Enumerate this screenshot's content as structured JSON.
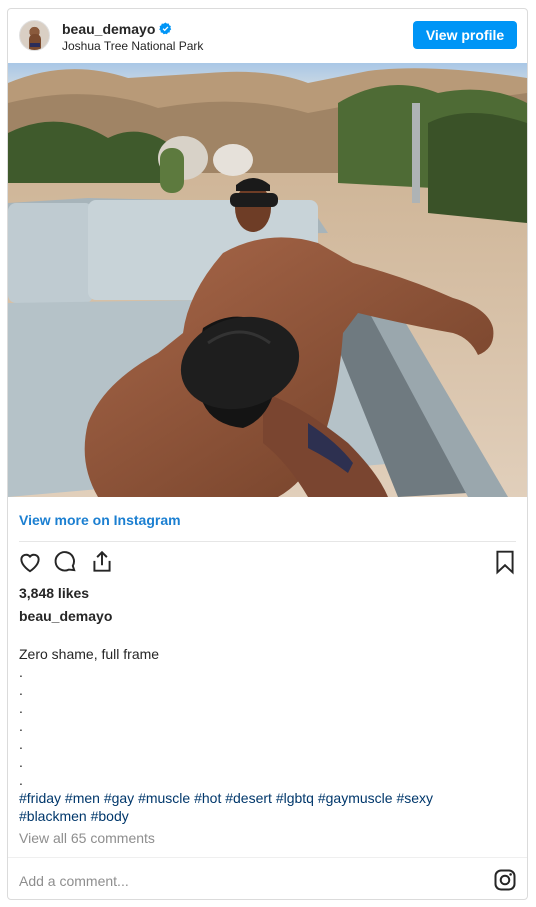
{
  "header": {
    "username": "beau_demayo",
    "location": "Joshua Tree National Park",
    "view_profile_label": "View profile"
  },
  "post": {
    "image_icon": "photo-man-on-couch-desert",
    "view_more_label": "View more on Instagram",
    "likes": "3,848 likes",
    "caption_user": "beau_demayo",
    "caption_text": "Zero shame, full frame",
    "caption_dots": [
      ".",
      ".",
      ".",
      ".",
      ".",
      ".",
      "."
    ],
    "hashtags_line1": "#friday #men #gay #muscle #hot #desert #lgbtq #gaymuscle #sexy",
    "hashtags_line2": "#blackmen #body",
    "view_comments": "View all 65 comments",
    "add_comment_placeholder": "Add a comment..."
  },
  "icons": [
    "verified-badge-icon",
    "heart-icon",
    "comment-icon",
    "share-icon",
    "bookmark-icon",
    "instagram-icon"
  ],
  "colors": {
    "accent": "#0095f6",
    "link": "#1b7fd1",
    "hashtag": "#00376b",
    "muted": "#8e8e8e"
  }
}
